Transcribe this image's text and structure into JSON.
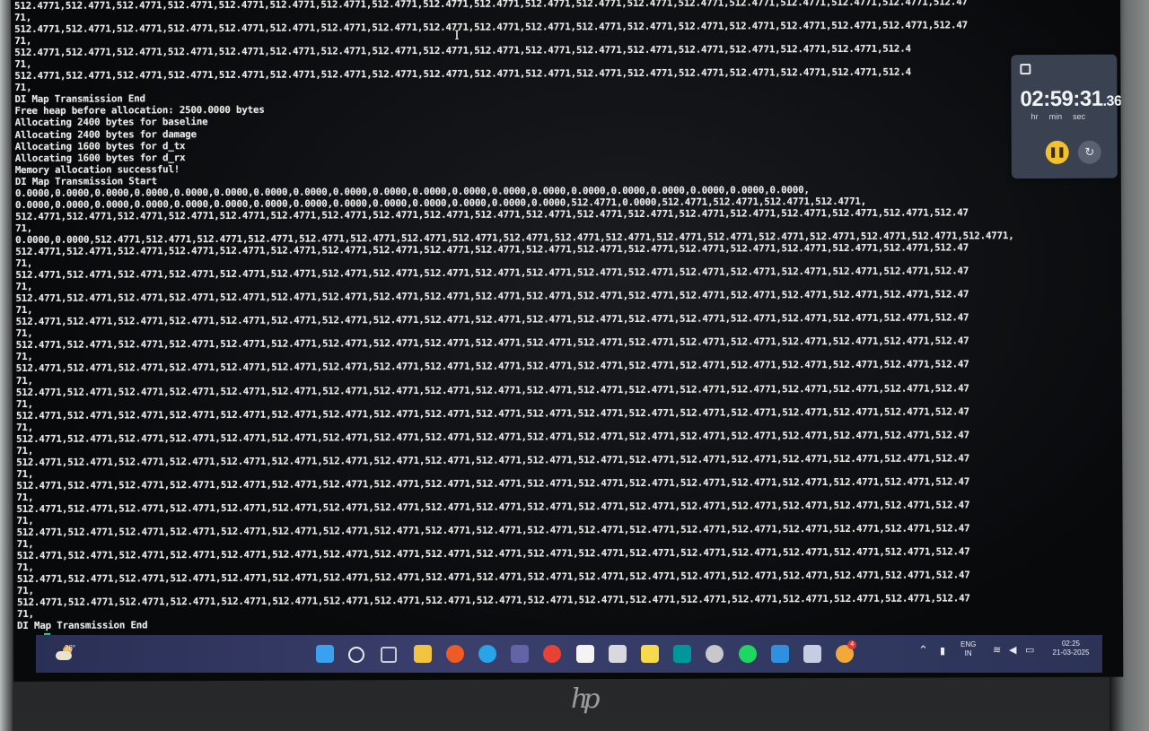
{
  "terminal": {
    "lines": [
      "512.4771,512.4771,512.4771,512.4771,512.4771,512.4771,512.4771,512.4771,512.4771,512.4771,512.4771,512.4771,512.4771,512.4771,512.4771,512.4771,512.4771,512.4771,512.47",
      "71,",
      "512.4771,512.4771,512.4771,512.4771,512.4771,512.4771,512.4771,512.4771,512.4771,512.4771,512.4771,512.4771,512.4771,512.4771,512.4771,512.4771,512.4771,512.4771,512.47",
      "71,",
      "512.4771,512.4771,512.4771,512.4771,512.4771,512.4771,512.4771,512.4771,512.4771,512.4771,512.4771,512.4771,512.4771,512.4771,512.4771,512.4771,512.4771,512.4",
      "71,",
      "512.4771,512.4771,512.4771,512.4771,512.4771,512.4771,512.4771,512.4771,512.4771,512.4771,512.4771,512.4771,512.4771,512.4771,512.4771,512.4771,512.4771,512.4",
      "71,",
      "DI Map Transmission End",
      "Free heap before allocation: 2500.0000 bytes",
      "Allocating 2400 bytes for baseline",
      "Allocating 2400 bytes for damage",
      "Allocating 1600 bytes for d_tx",
      "Allocating 1600 bytes for d_rx",
      "Memory allocation successful!",
      "DI Map Transmission Start",
      "0.0000,0.0000,0.0000,0.0000,0.0000,0.0000,0.0000,0.0000,0.0000,0.0000,0.0000,0.0000,0.0000,0.0000,0.0000,0.0000,0.0000,0.0000,0.0000,0.0000,",
      "0.0000,0.0000,0.0000,0.0000,0.0000,0.0000,0.0000,0.0000,0.0000,0.0000,0.0000,0.0000,0.0000,0.0000,512.4771,0.0000,512.4771,512.4771,512.4771,512.4771,",
      "512.4771,512.4771,512.4771,512.4771,512.4771,512.4771,512.4771,512.4771,512.4771,512.4771,512.4771,512.4771,512.4771,512.4771,512.4771,512.4771,512.4771,512.4771,512.47",
      "71,",
      "0.0000,0.0000,512.4771,512.4771,512.4771,512.4771,512.4771,512.4771,512.4771,512.4771,512.4771,512.4771,512.4771,512.4771,512.4771,512.4771,512.4771,512.4771,512.4771,512.4771,",
      "512.4771,512.4771,512.4771,512.4771,512.4771,512.4771,512.4771,512.4771,512.4771,512.4771,512.4771,512.4771,512.4771,512.4771,512.4771,512.4771,512.4771,512.4771,512.47",
      "71,",
      "512.4771,512.4771,512.4771,512.4771,512.4771,512.4771,512.4771,512.4771,512.4771,512.4771,512.4771,512.4771,512.4771,512.4771,512.4771,512.4771,512.4771,512.4771,512.47",
      "71,",
      "512.4771,512.4771,512.4771,512.4771,512.4771,512.4771,512.4771,512.4771,512.4771,512.4771,512.4771,512.4771,512.4771,512.4771,512.4771,512.4771,512.4771,512.4771,512.47",
      "71,",
      "512.4771,512.4771,512.4771,512.4771,512.4771,512.4771,512.4771,512.4771,512.4771,512.4771,512.4771,512.4771,512.4771,512.4771,512.4771,512.4771,512.4771,512.4771,512.47",
      "71,",
      "512.4771,512.4771,512.4771,512.4771,512.4771,512.4771,512.4771,512.4771,512.4771,512.4771,512.4771,512.4771,512.4771,512.4771,512.4771,512.4771,512.4771,512.4771,512.47",
      "71,",
      "512.4771,512.4771,512.4771,512.4771,512.4771,512.4771,512.4771,512.4771,512.4771,512.4771,512.4771,512.4771,512.4771,512.4771,512.4771,512.4771,512.4771,512.4771,512.47",
      "71,",
      "512.4771,512.4771,512.4771,512.4771,512.4771,512.4771,512.4771,512.4771,512.4771,512.4771,512.4771,512.4771,512.4771,512.4771,512.4771,512.4771,512.4771,512.4771,512.47",
      "71,",
      "512.4771,512.4771,512.4771,512.4771,512.4771,512.4771,512.4771,512.4771,512.4771,512.4771,512.4771,512.4771,512.4771,512.4771,512.4771,512.4771,512.4771,512.4771,512.47",
      "71,",
      "512.4771,512.4771,512.4771,512.4771,512.4771,512.4771,512.4771,512.4771,512.4771,512.4771,512.4771,512.4771,512.4771,512.4771,512.4771,512.4771,512.4771,512.4771,512.47",
      "71,",
      "512.4771,512.4771,512.4771,512.4771,512.4771,512.4771,512.4771,512.4771,512.4771,512.4771,512.4771,512.4771,512.4771,512.4771,512.4771,512.4771,512.4771,512.4771,512.47",
      "71,",
      "512.4771,512.4771,512.4771,512.4771,512.4771,512.4771,512.4771,512.4771,512.4771,512.4771,512.4771,512.4771,512.4771,512.4771,512.4771,512.4771,512.4771,512.4771,512.47",
      "71,",
      "512.4771,512.4771,512.4771,512.4771,512.4771,512.4771,512.4771,512.4771,512.4771,512.4771,512.4771,512.4771,512.4771,512.4771,512.4771,512.4771,512.4771,512.4771,512.47",
      "71,",
      "512.4771,512.4771,512.4771,512.4771,512.4771,512.4771,512.4771,512.4771,512.4771,512.4771,512.4771,512.4771,512.4771,512.4771,512.4771,512.4771,512.4771,512.4771,512.47",
      "71,",
      "512.4771,512.4771,512.4771,512.4771,512.4771,512.4771,512.4771,512.4771,512.4771,512.4771,512.4771,512.4771,512.4771,512.4771,512.4771,512.4771,512.4771,512.4771,512.47",
      "71,",
      "512.4771,512.4771,512.4771,512.4771,512.4771,512.4771,512.4771,512.4771,512.4771,512.4771,512.4771,512.4771,512.4771,512.4771,512.4771,512.4771,512.4771,512.4771,512.47",
      "71,",
      "512.4771,512.4771,512.4771,512.4771,512.4771,512.4771,512.4771,512.4771,512.4771,512.4771,512.4771,512.4771,512.4771,512.4771,512.4771,512.4771,512.4771,512.4771,512.47",
      "71,",
      "DI Map Transmission End"
    ],
    "cursor_color": "#2fe08a"
  },
  "stopwatch": {
    "time": "02:59:31",
    "fraction": ".36",
    "unit_hr": "hr",
    "unit_min": "min",
    "unit_sec": "sec",
    "pause_icon": "pause-icon",
    "reset_icon": "reset-icon",
    "accent": "#f3c12b"
  },
  "taskbar": {
    "weather_temp": "28°",
    "apps": [
      {
        "name": "start-icon",
        "color": "#3aa0f0"
      },
      {
        "name": "search-icon",
        "color": "#e8eaf0"
      },
      {
        "name": "task-view-icon",
        "color": "#c9ccd6"
      },
      {
        "name": "file-explorer-icon",
        "color": "#f2c240"
      },
      {
        "name": "brave-icon",
        "color": "#f05a24"
      },
      {
        "name": "edge-icon",
        "color": "#2aa4e8"
      },
      {
        "name": "teams-icon",
        "color": "#6264a7"
      },
      {
        "name": "chrome-icon",
        "color": "#e94235"
      },
      {
        "name": "notion-icon",
        "color": "#f4f4f4"
      },
      {
        "name": "calculator-icon",
        "color": "#d8d8de"
      },
      {
        "name": "sticky-notes-icon",
        "color": "#f7d94c"
      },
      {
        "name": "arduino-icon",
        "color": "#00979c"
      },
      {
        "name": "disk-icon",
        "color": "#c8c8cc"
      },
      {
        "name": "spotify-icon",
        "color": "#1ed760"
      },
      {
        "name": "vscode-icon",
        "color": "#2f8fe0"
      },
      {
        "name": "device-icon",
        "color": "#c6cde2"
      },
      {
        "name": "chrome-profile-icon",
        "color": "#f2a93b"
      }
    ],
    "chrome_badge": "4",
    "language": "ENG",
    "region": "IN",
    "time": "02:25",
    "date": "21-03-2025"
  },
  "brand": "hp"
}
